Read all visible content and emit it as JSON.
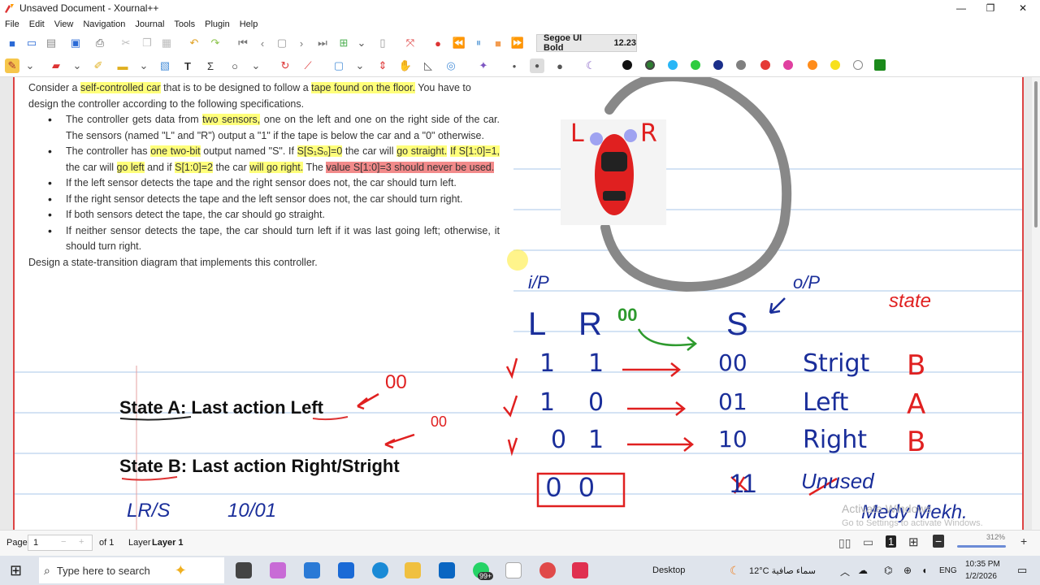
{
  "window": {
    "title": "Unsaved Document - Xournal++",
    "minimize": "—",
    "maximize": "❐",
    "close": "✕"
  },
  "menu": [
    "File",
    "Edit",
    "View",
    "Navigation",
    "Journal",
    "Tools",
    "Plugin",
    "Help"
  ],
  "toolbar": {
    "font_name": "Segoe UI Bold",
    "font_size": "12.23",
    "colors": [
      "#111111",
      "#2e7d32",
      "#29b6f6",
      "#2ecc40",
      "#1a2e8a",
      "#808080",
      "#e53935",
      "#e040a0",
      "#ff8c1a",
      "#f7e01c",
      "#ffffff",
      "#1b8a1b"
    ]
  },
  "document": {
    "intro_1": "Consider a ",
    "intro_hl1": "self-controlled car",
    "intro_2": " that is to be designed to follow a ",
    "intro_hl2": "tape found on the floor.",
    "intro_3": "  You have to design the controller according to the following specifications.",
    "b1_1": "The controller gets data from ",
    "b1_hl": "two sensors,",
    "b1_2": " one on the left and one on the right side of the car. The sensors (named \"L\" and \"R\") output a \"1\" if the tape is below the car and a \"0\" otherwise.",
    "b2_1": "The controller has ",
    "b2_hl1": "one two-bit",
    "b2_2": " output named \"S\".  If ",
    "b2_hl2": "S[S₁S₀]=0",
    "b2_3": " the car will ",
    "b2_hl3": "go straight.",
    "b2_4": " ",
    "b2_hl4": "If S[1:0]=1,",
    "b2_5": " the car will ",
    "b2_hl5": "go left",
    "b2_6": " and if ",
    "b2_hl6": "S[1:0]=2",
    "b2_7": " the car ",
    "b2_hl7": "will go right.",
    "b2_8": "  The ",
    "b2_hlr": "value S[1:0]=3 should never be used.",
    "b3": "If the left sensor detects the tape and the right sensor does not, the car should turn left.",
    "b4": "If the right sensor detects the tape and the left sensor does not, the car should turn right.",
    "b5": "If both sensors detect the tape, the car should go straight.",
    "b6": "If neither sensor detects the tape, the car should turn left if it was last going left; otherwise, it should turn right.",
    "design": "Design a state-transition diagram that implements this controller."
  },
  "states": {
    "a": "State A: Last action Left",
    "b": "State B: Last action Right/Stright"
  },
  "handwriting": {
    "ip": "i/P",
    "op": "o/P",
    "state": "state",
    "L": "L",
    "R": "R",
    "S": "S",
    "rows": [
      {
        "l": "1",
        "r": "1",
        "s": "00",
        "action": "Strigt",
        "st": "B"
      },
      {
        "l": "1",
        "r": "0",
        "s": "01",
        "action": "Left",
        "st": "A"
      },
      {
        "l": "0",
        "r": "1",
        "s": "10",
        "action": "Right",
        "st": "B"
      }
    ],
    "unused_in": "0  0",
    "unused_out": "11",
    "unused_label": "Unused",
    "oo_left": "00",
    "oo_right": "00",
    "oo_green": "00",
    "car_L": "L",
    "car_R": "R",
    "bottom_left": "LR/S",
    "bottom_mid": "10/01",
    "signature": "Medy Mekh."
  },
  "status": {
    "page_label": "Page",
    "page_value": "1",
    "page_of": "of 1",
    "layer_label": "Layer",
    "layer_value": "Layer 1",
    "zoom": "312%"
  },
  "watermark": {
    "line1": "Activate Windows",
    "line2": "Go to Settings to activate Windows."
  },
  "taskbar": {
    "search_placeholder": "Type here to search",
    "desktop": "Desktop",
    "weather": "12°C  سماء صافية",
    "lang": "ENG",
    "time": "10:35 PM",
    "date": "1/2/2026",
    "badge": "99+"
  }
}
